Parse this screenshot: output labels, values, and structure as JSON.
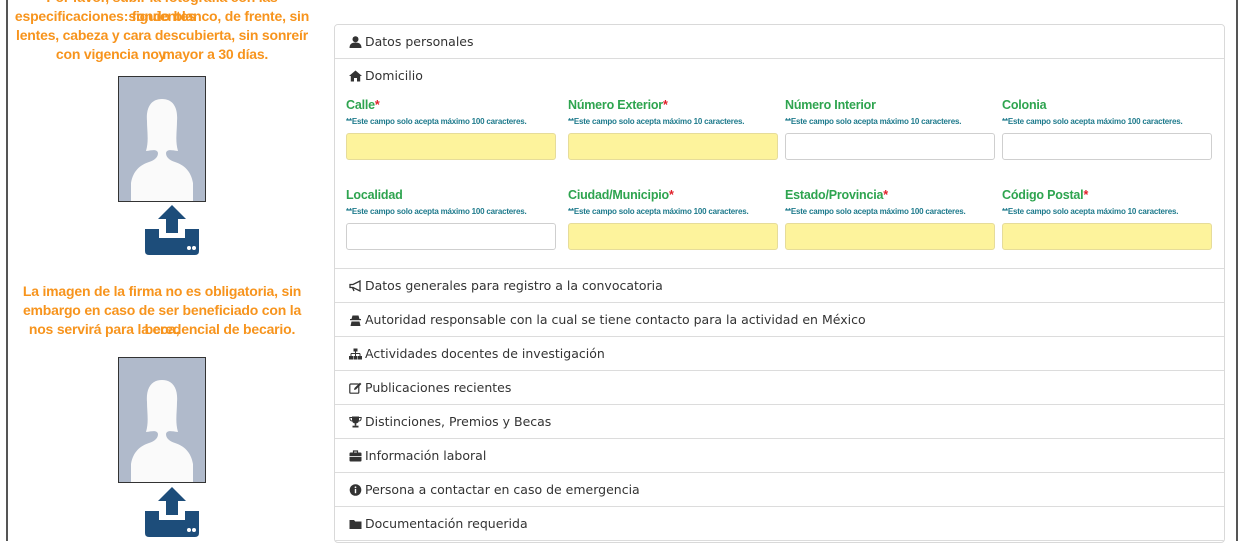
{
  "left": {
    "photo_instructions": [
      "Por favor, subir la fotografía con las siguientes",
      "especificaciones: fondo blanco, de frente, sin",
      "lentes, cabeza y cara descubierta, sin sonreír y",
      "con vigencia no mayor a 30 días."
    ],
    "signature_note": [
      "La imagen de la firma no es obligatoria, sin",
      "embargo en caso de ser beneficiado con la beca,",
      "nos servirá para la credencial de becario."
    ]
  },
  "sections": {
    "personal": "Datos personales",
    "domicilio": "Domicilio",
    "generales": "Datos generales para registro a la convocatoria",
    "autoridad": "Autoridad responsable con la cual se tiene contacto para la actividad en México",
    "actividades": "Actividades docentes de investigación",
    "publicaciones": "Publicaciones recientes",
    "distinciones": "Distinciones, Premios y Becas",
    "laboral": "Información laboral",
    "emergencia": "Persona a contactar en caso de emergencia",
    "documentacion": "Documentación requerida"
  },
  "fields": {
    "calle": {
      "label": "Calle",
      "required_mark": "*",
      "hint": "**Este campo solo acepta máximo 100 caracteres.",
      "value": ""
    },
    "numero_exterior": {
      "label": "Número Exterior",
      "required_mark": "*",
      "hint": "**Este campo solo acepta máximo 10 caracteres.",
      "value": ""
    },
    "numero_interior": {
      "label": "Número Interior",
      "required_mark": "",
      "hint": "**Este campo solo acepta máximo 10 caracteres.",
      "value": ""
    },
    "colonia": {
      "label": "Colonia",
      "required_mark": "",
      "hint": "**Este campo solo acepta máximo 100 caracteres.",
      "value": ""
    },
    "localidad": {
      "label": "Localidad",
      "required_mark": "",
      "hint": "**Este campo solo acepta máximo 100 caracteres.",
      "value": ""
    },
    "ciudad": {
      "label": "Ciudad/Municipio",
      "required_mark": "*",
      "hint": "**Este campo solo acepta máximo 100 caracteres.",
      "value": ""
    },
    "estado": {
      "label": "Estado/Provincia",
      "required_mark": "*",
      "hint": "**Este campo solo acepta máximo 100 caracteres.",
      "value": ""
    },
    "codigo_postal": {
      "label": "Código Postal",
      "required_mark": "*",
      "hint": "**Este campo solo acepta máximo 10 caracteres.",
      "value": ""
    }
  },
  "icons": {
    "personal": "user-icon",
    "domicilio": "home-icon",
    "generales": "bullhorn-icon",
    "autoridad": "user-secret-icon",
    "actividades": "sitemap-icon",
    "publicaciones": "edit-icon",
    "distinciones": "trophy-icon",
    "laboral": "briefcase-icon",
    "emergencia": "info-circle-icon",
    "documentacion": "folder-icon",
    "upload": "upload-icon"
  },
  "colors": {
    "instruction_text": "#f7941d",
    "field_label": "#2ea44f",
    "required_mark": "#e0202a",
    "hint_text": "#1e7a8c",
    "required_input_bg": "#fdf39c",
    "icon_dark": "#1d4d7a"
  }
}
